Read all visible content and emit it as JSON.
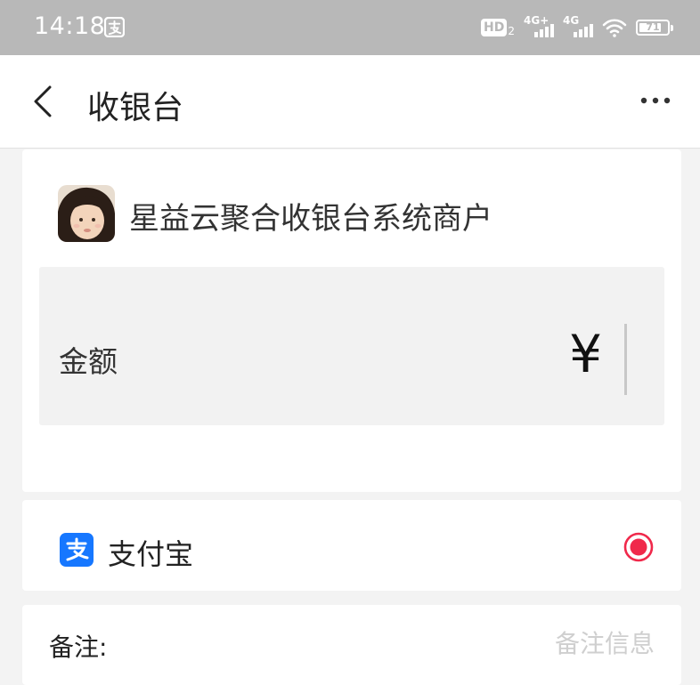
{
  "status_bar": {
    "time": "14:18",
    "hd_label": "HD",
    "hd_sub": "2",
    "signal1_label": "4G+",
    "signal2_label": "4G",
    "battery": "71"
  },
  "nav": {
    "title": "收银台"
  },
  "merchant": {
    "name": "星益云聚合收银台系统商户"
  },
  "amount": {
    "label": "金额",
    "currency_symbol": "¥",
    "value": ""
  },
  "payment": {
    "method_label": "支付宝",
    "selected": true
  },
  "note": {
    "label": "备注:",
    "placeholder": "备注信息",
    "value": ""
  },
  "colors": {
    "status_bar_bg": "#b8b8b8",
    "alipay_blue": "#1677ff",
    "radio_red": "#f0294b"
  },
  "icons": [
    "alipay-icon",
    "signal-icon",
    "wifi-icon",
    "battery-icon",
    "back-icon",
    "more-icon",
    "radio-selected-icon",
    "avatar"
  ]
}
